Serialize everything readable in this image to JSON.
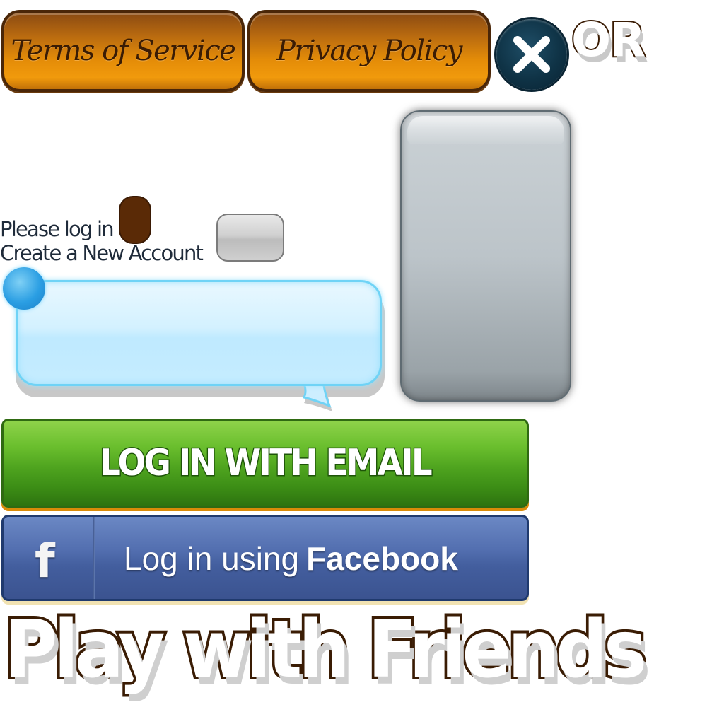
{
  "buttons": {
    "terms": "Terms of Service",
    "privacy": "Privacy Policy",
    "or": "OR",
    "email_login": "LOG IN WITH EMAIL",
    "facebook_prefix": "Log in using",
    "facebook_brand": "Facebook",
    "facebook_icon_letter": "f"
  },
  "login": {
    "please_log_in": "Please log in",
    "create_account": "Create a New Account"
  },
  "title": "Play with Friends",
  "icons": {
    "close": "close-icon",
    "facebook": "facebook-icon"
  },
  "colors": {
    "orange_button": "#e48c08",
    "dark_brown": "#3a1c04",
    "close_circle": "#0f3346",
    "bubble_blue": "#6fd3f6",
    "email_green": "#4fa41f",
    "facebook_blue": "#435e9e",
    "panel_grey": "#bcc4c9"
  }
}
